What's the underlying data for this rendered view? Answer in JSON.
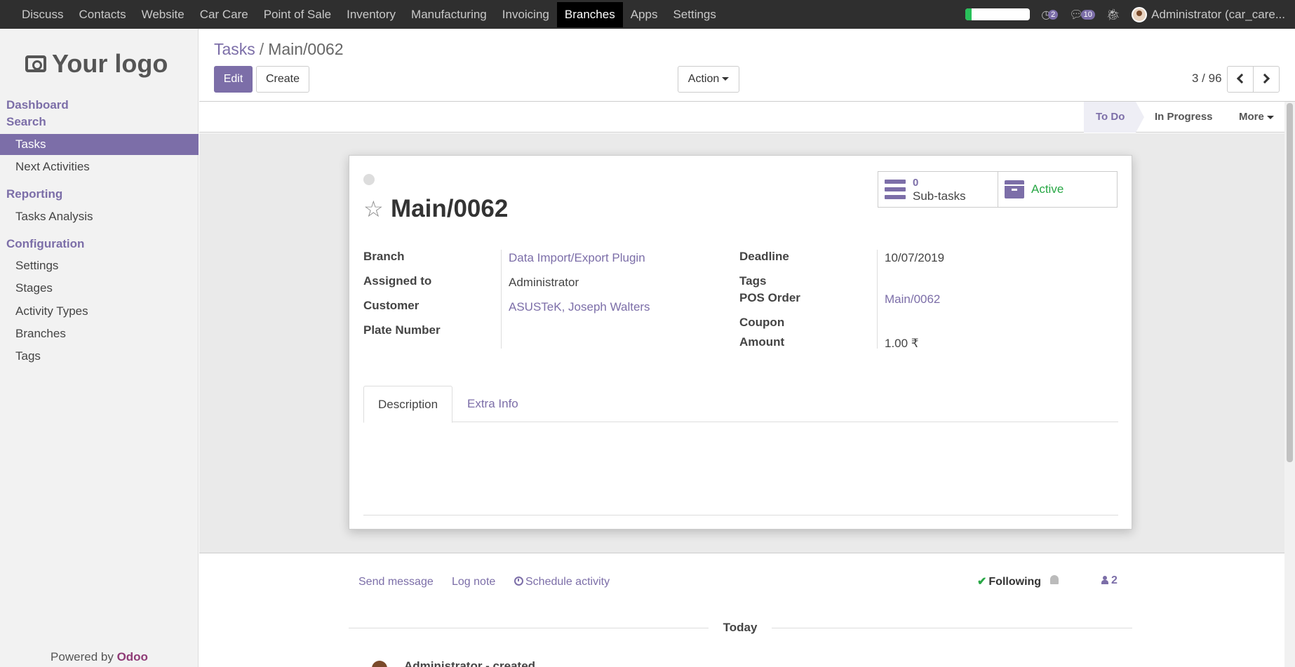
{
  "navbar": {
    "menu": [
      "Discuss",
      "Contacts",
      "Website",
      "Car Care",
      "Point of Sale",
      "Inventory",
      "Manufacturing",
      "Invoicing",
      "Branches",
      "Apps",
      "Settings"
    ],
    "active_index": 8,
    "progress_fraction": 0.1,
    "activity_count": "2",
    "messages_count": "10",
    "user_name": "Administrator (car_care..."
  },
  "sidebar": {
    "logo_text": "Your logo",
    "dashboard": "Dashboard",
    "search": "Search",
    "tasks": "Tasks",
    "next_activities": "Next Activities",
    "reporting": "Reporting",
    "tasks_analysis": "Tasks Analysis",
    "configuration": "Configuration",
    "settings": "Settings",
    "stages": "Stages",
    "activity_types": "Activity Types",
    "branches": "Branches",
    "tags": "Tags",
    "powered_by": "Powered by",
    "brand": "Odoo"
  },
  "control_panel": {
    "breadcrumb_parent": "Tasks",
    "breadcrumb_sep": "/",
    "breadcrumb_current": "Main/0062",
    "edit": "Edit",
    "create": "Create",
    "action": "Action",
    "pager": "3 / 96"
  },
  "statusbar": {
    "todo": "To Do",
    "in_progress": "In Progress",
    "more": "More"
  },
  "record": {
    "title": "Main/0062",
    "subtasks_count": "0",
    "subtasks_label": "Sub-tasks",
    "active_label": "Active",
    "labels": {
      "branch": "Branch",
      "assigned_to": "Assigned to",
      "customer": "Customer",
      "plate_number": "Plate Number",
      "deadline": "Deadline",
      "tags": "Tags",
      "pos_order": "POS Order",
      "coupon": "Coupon",
      "amount": "Amount"
    },
    "values": {
      "branch": "Data Import/Export Plugin",
      "assigned_to": "Administrator",
      "customer": "ASUSTeK, Joseph Walters",
      "deadline": "10/07/2019",
      "pos_order": "Main/0062",
      "amount": "1.00 ₹"
    },
    "tabs": [
      "Description",
      "Extra Info"
    ]
  },
  "chatter": {
    "send_message": "Send message",
    "log_note": "Log note",
    "schedule_activity": "Schedule activity",
    "following": "Following",
    "followers_count": "2",
    "today": "Today",
    "partial_message": "Administrator - created"
  },
  "colors": {
    "accent": "#7c6ea8",
    "navbar_bg": "#2f2f2f",
    "active_green": "#28a745"
  }
}
